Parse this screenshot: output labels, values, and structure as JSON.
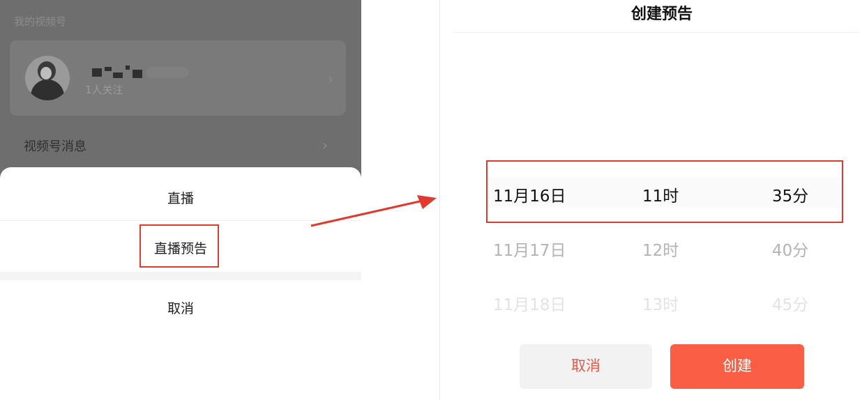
{
  "left_screen": {
    "section_label": "我的视频号",
    "account": {
      "follower_count": "1人关注"
    },
    "menu": {
      "messages_label": "视频号消息"
    },
    "action_sheet": {
      "live_label": "直播",
      "live_preview_label": "直播预告",
      "cancel_label": "取消"
    }
  },
  "right_screen": {
    "title": "创建预告",
    "picker": {
      "rows": [
        {
          "date": "11月16日",
          "hour": "11时",
          "minute": "35分"
        },
        {
          "date": "11月17日",
          "hour": "12时",
          "minute": "40分"
        },
        {
          "date": "11月18日",
          "hour": "13时",
          "minute": "45分"
        }
      ],
      "selected_index": 0
    },
    "buttons": {
      "cancel_label": "取消",
      "create_label": "创建"
    }
  },
  "colors": {
    "highlight_red": "#e03a2f",
    "create_button": "#fa5f45",
    "cancel_text": "#e8594a"
  }
}
